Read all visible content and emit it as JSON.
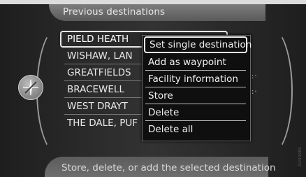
{
  "header": {
    "title": "Previous destinations"
  },
  "destinations": [
    {
      "label": "PIELD HEATH"
    },
    {
      "label": "WISHAW, LAN"
    },
    {
      "label": "GREATFIELDS"
    },
    {
      "label": "BRACEWELL"
    },
    {
      "label": "WEST DRAYT"
    },
    {
      "label": "THE DALE, PUF"
    }
  ],
  "context_menu": {
    "items": [
      {
        "label": "Set single destination"
      },
      {
        "label": "Add as waypoint"
      },
      {
        "label": "Facility information"
      },
      {
        "label": "Store"
      },
      {
        "label": "Delete"
      },
      {
        "label": "Delete all"
      }
    ]
  },
  "footer": {
    "hint": "Store, delete, or add the selected destination"
  },
  "compass": {
    "icon": "compass-icon"
  },
  "figure_code": "G044480",
  "colors": {
    "background": "#2b2b2b",
    "highlight_border": "#e6e6e6",
    "text": "#e8e8e8"
  }
}
